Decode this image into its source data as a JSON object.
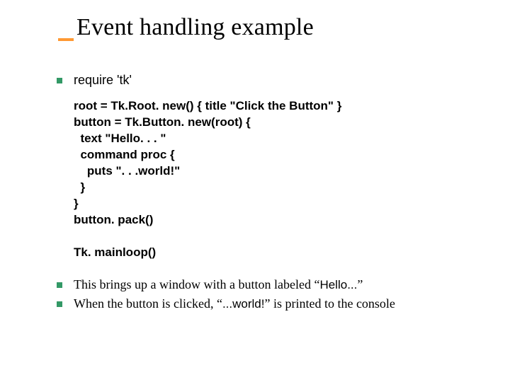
{
  "title": "Event handling example",
  "bullets": {
    "b1": "require 'tk'",
    "b2": {
      "pre": "This brings up a window with a button labeled “",
      "mid": "Hello...",
      "post": "”"
    },
    "b3": {
      "pre": "When the button is clicked, “",
      "mid": "...world!",
      "post": "” is printed to the console"
    }
  },
  "code": "root = Tk.Root. new() { title \"Click the Button\" }\nbutton = Tk.Button. new(root) {\n  text \"Hello. . . \"\n  command proc {\n    puts \". . .world!\"\n  }\n}\nbutton. pack()\n\nTk. mainloop()"
}
